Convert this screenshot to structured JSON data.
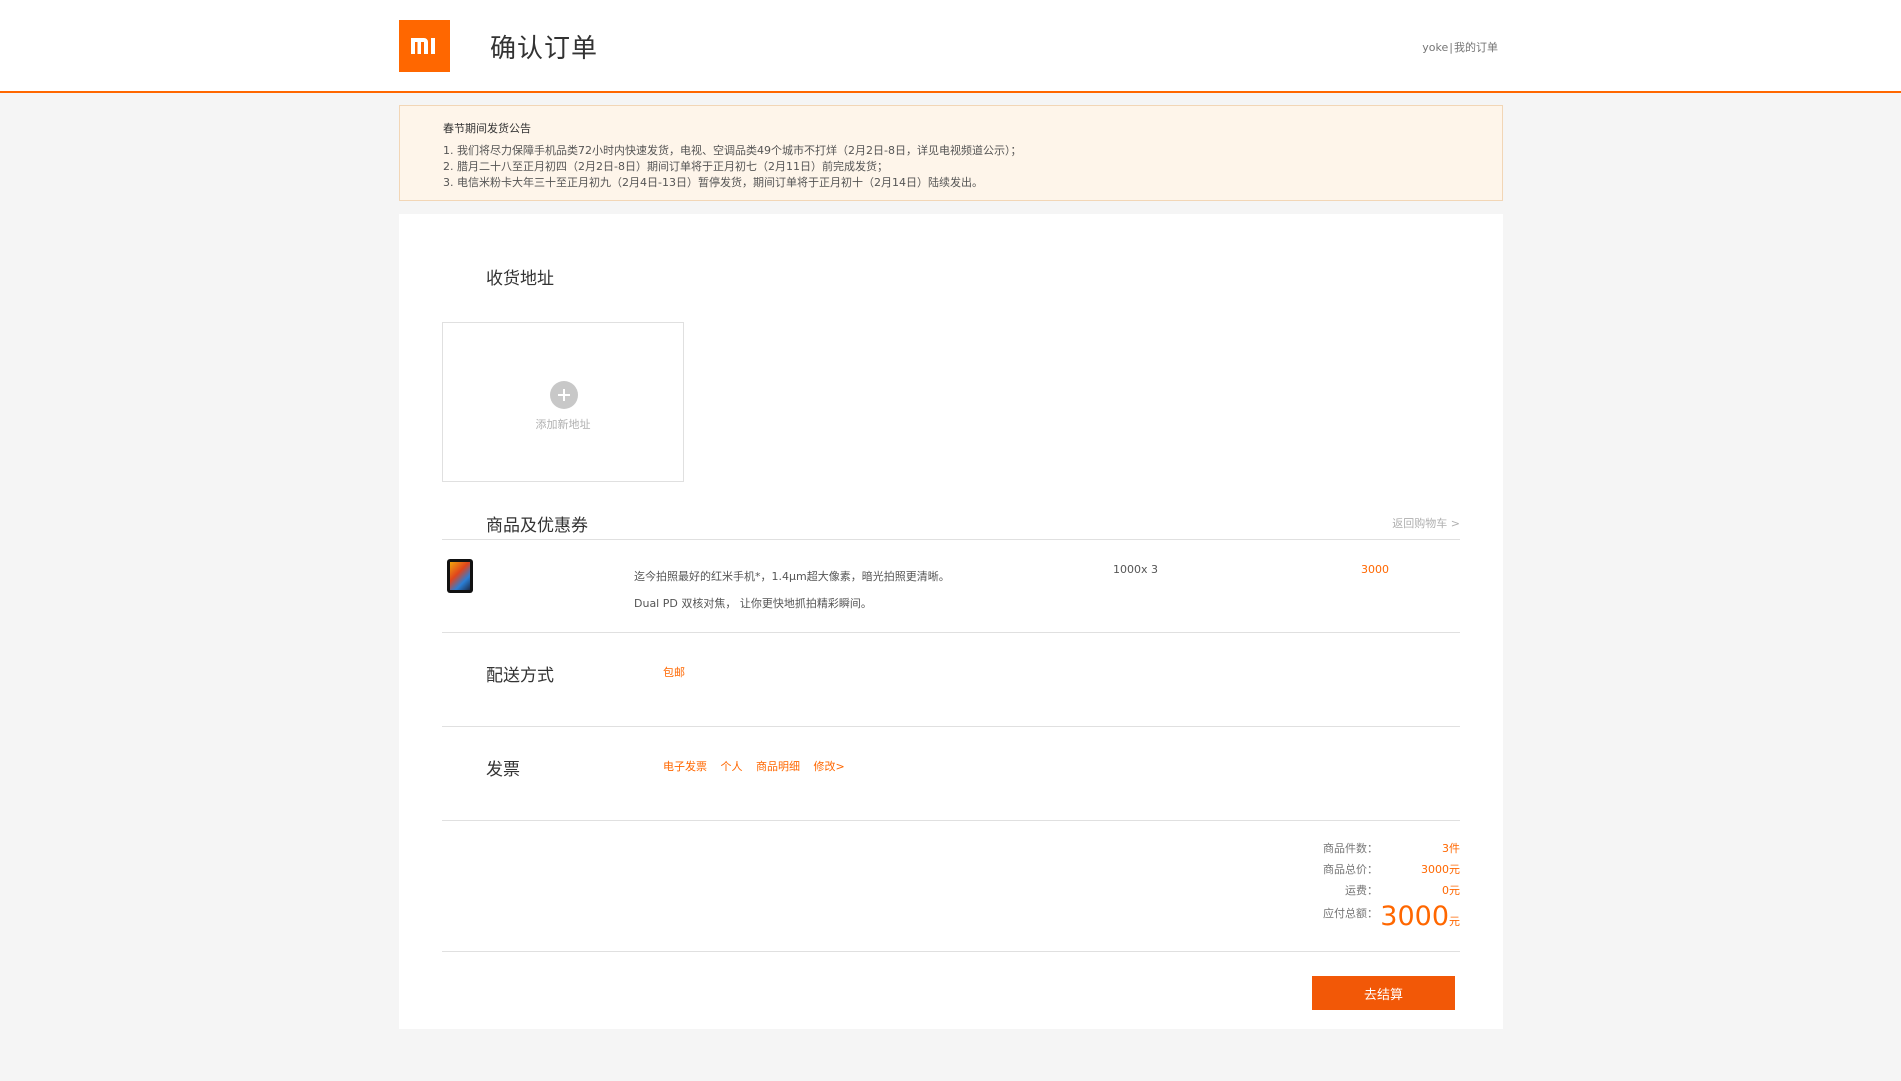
{
  "header": {
    "logo_text": "mi",
    "title": "确认订单",
    "username": "yoke",
    "separator": "|",
    "my_orders": "我的订单"
  },
  "notice": {
    "title": "春节期间发货公告",
    "lines": [
      "1. 我们将尽力保障手机品类72小时内快速发货，电视、空调品类49个城市不打烊（2月2日-8日，详见电视频道公示）；",
      "2. 腊月二十八至正月初四（2月2日-8日）期间订单将于正月初七（2月11日）前完成发货；",
      "3. 电信米粉卡大年三十至正月初九（2月4日-13日）暂停发货，期间订单将于正月初十（2月14日）陆续发出。"
    ]
  },
  "address": {
    "section_title": "收货地址",
    "add_label": "添加新地址",
    "add_icon": "plus-circle-icon"
  },
  "goods": {
    "section_title": "商品及优惠券",
    "back_link": "返回购物车 >",
    "item": {
      "description": "迄今拍照最好的红米手机*，1.4μm超大像素，暗光拍照更清晰。Dual PD 双核对焦， 让你更快地抓拍精彩瞬间。",
      "quantity": "1000x 3",
      "price": "3000"
    }
  },
  "shipping": {
    "section_title": "配送方式",
    "value": "包邮"
  },
  "invoice": {
    "section_title": "发票",
    "type": "电子发票",
    "holder": "个人",
    "content": "商品明细",
    "edit_link": "修改>"
  },
  "summary": {
    "count_label": "商品件数：",
    "count_value": "3件",
    "total_label": "商品总价：",
    "total_value": "3000元",
    "freight_label": "运费：",
    "freight_value": "0元",
    "payable_label": "应付总额：",
    "payable_amount": "3000",
    "payable_unit": "元"
  },
  "checkout_button": "去结算",
  "colors": {
    "accent": "#ff6700",
    "notice_bg": "#fef5ea",
    "button": "#f25807"
  }
}
